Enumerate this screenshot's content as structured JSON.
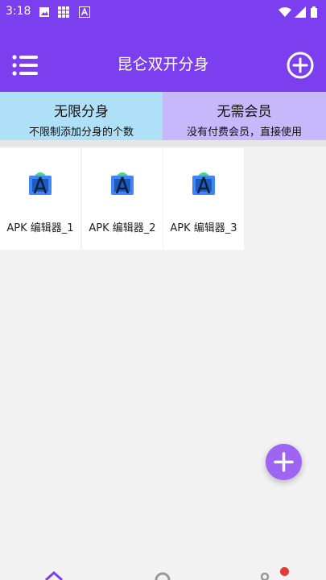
{
  "status_bar": {
    "time": "3:18"
  },
  "app_bar": {
    "title": "昆仑双开分身"
  },
  "banners": [
    {
      "title": "无限分身",
      "subtitle": "不限制添加分身的个数"
    },
    {
      "title": "无需会员",
      "subtitle": "没有付费会员，直接使用"
    }
  ],
  "apps": [
    {
      "label": "APK 编辑器_1"
    },
    {
      "label": "APK 编辑器_2"
    },
    {
      "label": "APK 编辑器_3"
    }
  ],
  "colors": {
    "primary": "#7b3ff0",
    "fab": "#9e64f2",
    "banner_left": "#aee0f7",
    "banner_right": "#c7b8fb"
  }
}
